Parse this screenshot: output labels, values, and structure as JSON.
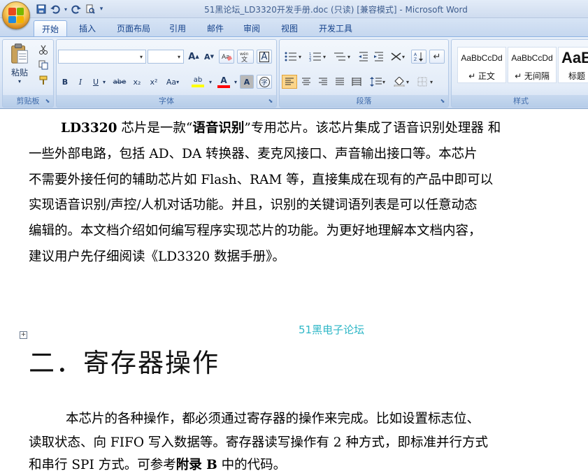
{
  "window": {
    "title": "51黑论坛_LD3320开发手册.doc (只读) [兼容模式] - Microsoft Word"
  },
  "quick_access": {
    "icons": [
      "save-icon",
      "undo-icon",
      "redo-icon",
      "print-preview-icon",
      "customize-icon"
    ]
  },
  "tabs": [
    {
      "label": "开始",
      "active": true
    },
    {
      "label": "插入",
      "active": false
    },
    {
      "label": "页面布局",
      "active": false
    },
    {
      "label": "引用",
      "active": false
    },
    {
      "label": "邮件",
      "active": false
    },
    {
      "label": "审阅",
      "active": false
    },
    {
      "label": "视图",
      "active": false
    },
    {
      "label": "开发工具",
      "active": false
    }
  ],
  "ribbon": {
    "clipboard": {
      "label": "剪贴板",
      "paste_label": "粘贴"
    },
    "font": {
      "label": "字体",
      "font_name": "",
      "font_size": "",
      "grow": "A",
      "shrink": "A",
      "bold": "B",
      "italic": "I",
      "underline": "U",
      "strike": "abe",
      "sub": "x₂",
      "sup": "x²",
      "case": "Aa",
      "highlight": "ab",
      "font_color": "A",
      "char_shade": "A",
      "enclose": "字"
    },
    "paragraph": {
      "label": "段落"
    },
    "styles": {
      "label": "样式",
      "items": [
        {
          "sample": "AaBbCcDd",
          "name": "↵ 正文"
        },
        {
          "sample": "AaBbCcDd",
          "name": "↵ 无间隔"
        },
        {
          "sample": "AaB",
          "name": "标题"
        }
      ]
    }
  },
  "colors": {
    "accent": "#15428b",
    "watermark": "#2fb7c7",
    "highlight": "#ffff00",
    "font_color_bar": "#ff0000"
  },
  "document": {
    "para1": {
      "lines": [
        "LD3320 芯片是一款“语音识别”专用芯片。该芯片集成了语音识别处理器 和",
        "一些外部电路，包括 AD、DA 转换器、麦克风接口、声音输出接口等。本芯片",
        "不需要外接任何的辅助芯片如 Flash、RAM 等，直接集成在现有的产品中即可以",
        "实现语音识别/声控/人机对话功能。并且，识别的关键词语列表是可以任意动态",
        "编辑的。本文档介绍如何编写程序实现芯片的功能。为更好地理解本文档内容，",
        "建议用户先仔细阅读《LD3320 数据手册》。"
      ]
    },
    "watermark": "51黑电子论坛",
    "heading": "二．寄存器操作",
    "para2": {
      "lines": [
        "本芯片的各种操作，都必须通过寄存器的操作来完成。比如设置标志位、",
        "读取状态、向 FIFO 写入数据等。寄存器读写操作有 2 种方式，即标准并行方式",
        "和串行 SPI 方式。可参考附录 B 中的代码。"
      ]
    }
  }
}
